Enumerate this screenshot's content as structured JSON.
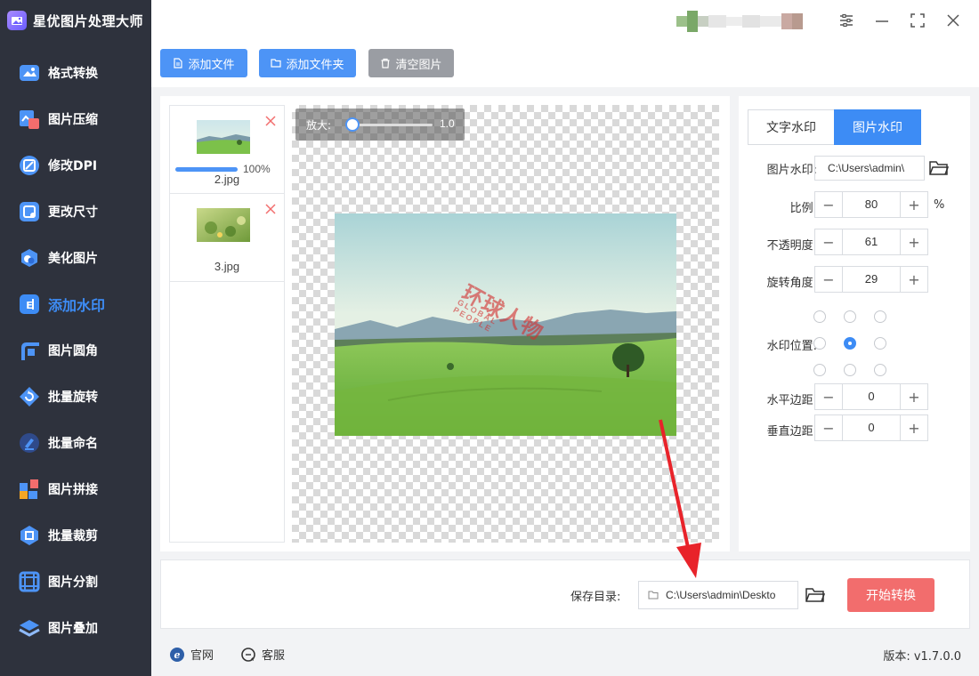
{
  "app": {
    "title": "星优图片处理大师"
  },
  "sidebar": {
    "items": [
      {
        "label": "格式转换",
        "icon": "format-convert-icon",
        "active": false
      },
      {
        "label": "图片压缩",
        "icon": "compress-icon",
        "active": false
      },
      {
        "label": "修改DPI",
        "icon": "dpi-icon",
        "active": false
      },
      {
        "label": "更改尺寸",
        "icon": "resize-icon",
        "active": false
      },
      {
        "label": "美化图片",
        "icon": "beautify-icon",
        "active": false
      },
      {
        "label": "添加水印",
        "icon": "watermark-icon",
        "active": true
      },
      {
        "label": "图片圆角",
        "icon": "round-corner-icon",
        "active": false
      },
      {
        "label": "批量旋转",
        "icon": "rotate-icon",
        "active": false
      },
      {
        "label": "批量命名",
        "icon": "rename-icon",
        "active": false
      },
      {
        "label": "图片拼接",
        "icon": "stitch-icon",
        "active": false
      },
      {
        "label": "批量裁剪",
        "icon": "crop-icon",
        "active": false
      },
      {
        "label": "图片分割",
        "icon": "split-icon",
        "active": false
      },
      {
        "label": "图片叠加",
        "icon": "overlay-icon",
        "active": false
      }
    ]
  },
  "toolbar": {
    "add_file": "添加文件",
    "add_folder": "添加文件夹",
    "clear_images": "清空图片"
  },
  "files": [
    {
      "name": "2.jpg",
      "progress": "100%",
      "progress_value": 1.0
    },
    {
      "name": "3.jpg"
    }
  ],
  "preview": {
    "zoom_label": "放大:",
    "zoom_value": "1.0",
    "watermark_text": "环球人物",
    "watermark_subtext": "GLOBAL PEOPLE"
  },
  "settings": {
    "tabs": [
      "文字水印",
      "图片水印"
    ],
    "active_tab": "图片水印",
    "image_watermark_label": "图片水印:",
    "image_watermark_path": "C:\\Users\\admin\\",
    "scale_label": "比例:",
    "scale_value": "80",
    "scale_unit": "%",
    "opacity_label": "不透明度:",
    "opacity_value": "61",
    "rotation_label": "旋转角度:",
    "rotation_value": "29",
    "position_label": "水印位置:",
    "position_selected": "center",
    "h_margin_label": "水平边距:",
    "h_margin_value": "0",
    "v_margin_label": "垂直边距:",
    "v_margin_value": "0"
  },
  "save": {
    "label": "保存目录:",
    "path": "C:\\Users\\admin\\Deskto",
    "start_button": "开始转换"
  },
  "footer": {
    "website": "官网",
    "support": "客服",
    "version": "版本: v1.7.0.0"
  },
  "colors": {
    "sidebar_bg": "#2e323d",
    "accent": "#3d8cf5",
    "start_button": "#f26d6d",
    "annotation_arrow": "#e8232a"
  }
}
